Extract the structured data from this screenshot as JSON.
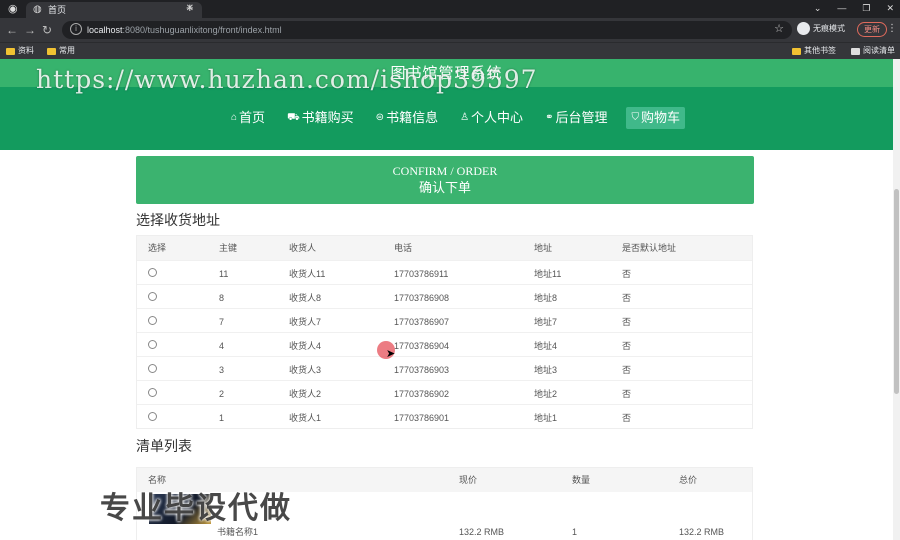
{
  "browser": {
    "tab_title": "首页",
    "url_host": "localhost",
    "url_rest": ":8080/tushuguanlixitong/front/index.html",
    "incognito_label": "无痕模式",
    "update_label": "更新",
    "bookmarks": [
      "资料",
      "常用"
    ],
    "bookmarks_right": [
      "其他书签",
      "阅读清单"
    ]
  },
  "site": {
    "title": "图书馆管理系统",
    "nav": [
      {
        "label": "首页",
        "icon": "home-icon",
        "glyph": "⌂"
      },
      {
        "label": "书籍购买",
        "icon": "cart-book-icon",
        "glyph": "⛟"
      },
      {
        "label": "书籍信息",
        "icon": "book-info-icon",
        "glyph": "⊜"
      },
      {
        "label": "个人中心",
        "icon": "user-icon",
        "glyph": "♙"
      },
      {
        "label": "后台管理",
        "icon": "link-icon",
        "glyph": "⚭"
      },
      {
        "label": "购物车",
        "icon": "cart-icon",
        "glyph": "⛉"
      }
    ]
  },
  "confirm": {
    "en": "CONFIRM / ORDER",
    "zh": "确认下单"
  },
  "address_section": {
    "title": "选择收货地址",
    "headers": [
      "选择",
      "主键",
      "收货人",
      "电话",
      "地址",
      "是否默认地址"
    ],
    "rows": [
      {
        "id": "11",
        "name": "收货人11",
        "phone": "17703786911",
        "addr": "地址11",
        "default": "否"
      },
      {
        "id": "8",
        "name": "收货人8",
        "phone": "17703786908",
        "addr": "地址8",
        "default": "否"
      },
      {
        "id": "7",
        "name": "收货人7",
        "phone": "17703786907",
        "addr": "地址7",
        "default": "否"
      },
      {
        "id": "4",
        "name": "收货人4",
        "phone": "17703786904",
        "addr": "地址4",
        "default": "否"
      },
      {
        "id": "3",
        "name": "收货人3",
        "phone": "17703786903",
        "addr": "地址3",
        "default": "否"
      },
      {
        "id": "2",
        "name": "收货人2",
        "phone": "17703786902",
        "addr": "地址2",
        "default": "否"
      },
      {
        "id": "1",
        "name": "收货人1",
        "phone": "17703786901",
        "addr": "地址1",
        "default": "否"
      }
    ]
  },
  "order_section": {
    "title": "清单列表",
    "headers": [
      "名称",
      "现价",
      "数量",
      "总价"
    ],
    "rows": [
      {
        "name": "书籍名称1",
        "price": "132.2 RMB",
        "qty": "1",
        "total": "132.2 RMB"
      }
    ]
  },
  "watermarks": {
    "url": "https://www.huzhan.com/ishop39597",
    "cn": "专业毕设代做"
  }
}
